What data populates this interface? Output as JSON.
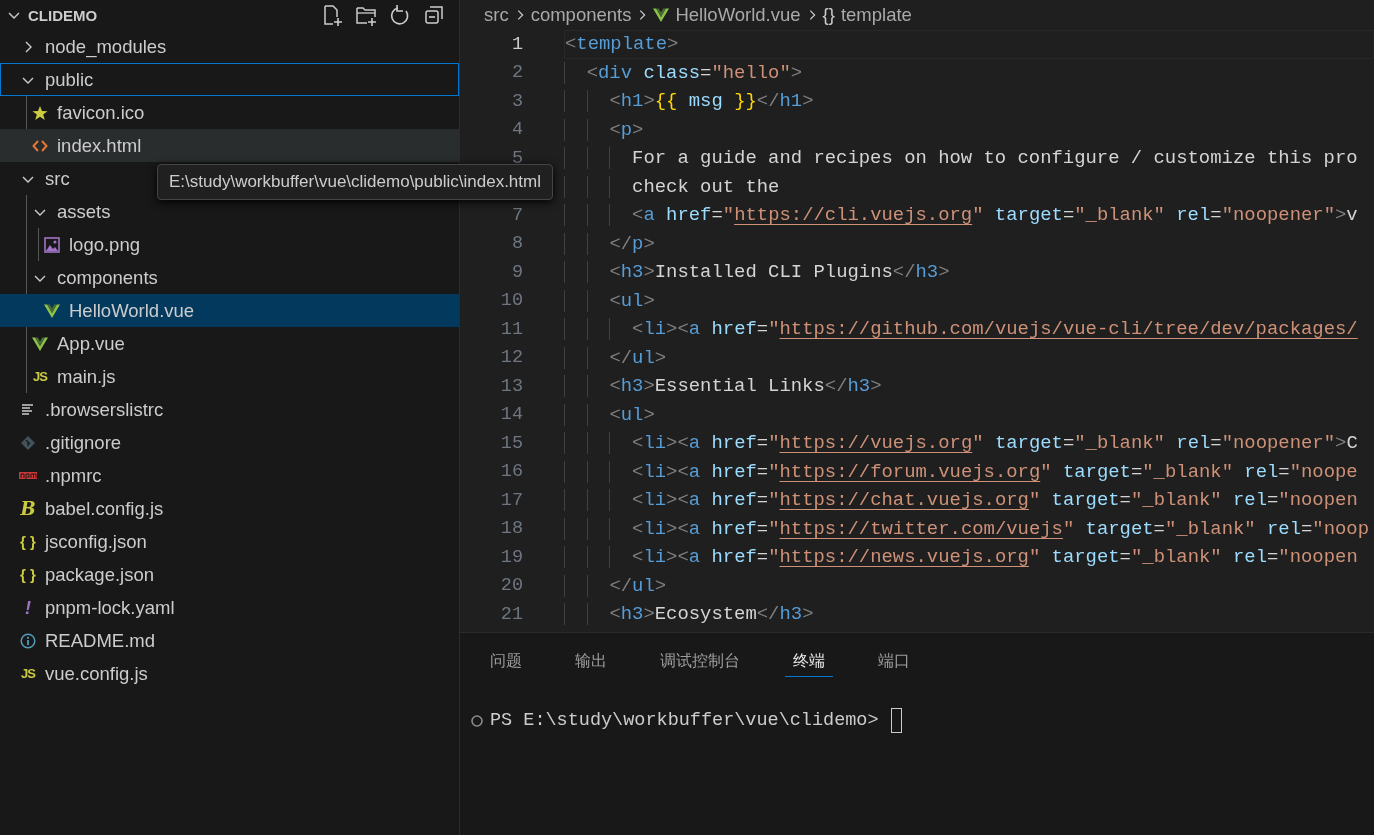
{
  "sidebar": {
    "title": "CLIDEMO",
    "expanded": true,
    "tree": [
      {
        "name": "node_modules",
        "kind": "folder",
        "expanded": false,
        "selected": false,
        "focused": false,
        "hovered": false
      },
      {
        "name": "public",
        "kind": "folder",
        "expanded": true,
        "selected": false,
        "focused": true,
        "hovered": false,
        "children": [
          {
            "name": "favicon.ico",
            "kind": "star",
            "selected": false,
            "focused": false,
            "hovered": false
          },
          {
            "name": "index.html",
            "kind": "html",
            "selected": false,
            "focused": false,
            "hovered": true
          }
        ]
      },
      {
        "name": "src",
        "kind": "folder",
        "expanded": true,
        "selected": false,
        "focused": false,
        "hovered": false,
        "children": [
          {
            "name": "assets",
            "kind": "folder",
            "expanded": true,
            "selected": false,
            "focused": false,
            "hovered": false,
            "children": [
              {
                "name": "logo.png",
                "kind": "image",
                "selected": false,
                "focused": false,
                "hovered": false
              }
            ]
          },
          {
            "name": "components",
            "kind": "folder",
            "expanded": true,
            "selected": false,
            "focused": false,
            "hovered": false,
            "children": [
              {
                "name": "HelloWorld.vue",
                "kind": "vue",
                "selected": true,
                "focused": false,
                "hovered": false
              }
            ]
          },
          {
            "name": "App.vue",
            "kind": "vue",
            "selected": false,
            "focused": false,
            "hovered": false
          },
          {
            "name": "main.js",
            "kind": "js",
            "icon_text": "JS",
            "selected": false,
            "focused": false,
            "hovered": false
          }
        ]
      },
      {
        "name": ".browserslistrc",
        "kind": "lines",
        "selected": false,
        "focused": false,
        "hovered": false
      },
      {
        "name": ".gitignore",
        "kind": "git",
        "selected": false,
        "focused": false,
        "hovered": false
      },
      {
        "name": ".npmrc",
        "kind": "npm",
        "selected": false,
        "focused": false,
        "hovered": false
      },
      {
        "name": "babel.config.js",
        "kind": "babel",
        "icon_text": "B",
        "selected": false,
        "focused": false,
        "hovered": false
      },
      {
        "name": "jsconfig.json",
        "kind": "json",
        "icon_text": "{ }",
        "selected": false,
        "focused": false,
        "hovered": false
      },
      {
        "name": "package.json",
        "kind": "json",
        "icon_text": "{ }",
        "selected": false,
        "focused": false,
        "hovered": false
      },
      {
        "name": "pnpm-lock.yaml",
        "kind": "yaml",
        "icon_text": "!",
        "selected": false,
        "focused": false,
        "hovered": false
      },
      {
        "name": "README.md",
        "kind": "info",
        "selected": false,
        "focused": false,
        "hovered": false
      },
      {
        "name": "vue.config.js",
        "kind": "js",
        "icon_text": "JS",
        "selected": false,
        "focused": false,
        "hovered": false
      }
    ]
  },
  "tooltip": {
    "text": "E:\\study\\workbuffer\\vue\\clidemo\\public\\index.html"
  },
  "breadcrumb": [
    {
      "label": "src",
      "kind": "folder"
    },
    {
      "label": "components",
      "kind": "folder"
    },
    {
      "label": "HelloWorld.vue",
      "kind": "vue"
    },
    {
      "label": "template",
      "kind": "symbol",
      "icon_text": "{}"
    }
  ],
  "editor": {
    "lines": [
      {
        "number": "1",
        "current": true,
        "tokens": [
          {
            "kind": "punct",
            "text": "<"
          },
          {
            "kind": "tag",
            "text": "template"
          },
          {
            "kind": "punct",
            "text": ">"
          }
        ]
      },
      {
        "number": "2",
        "current": false,
        "tokens": [
          {
            "kind": "punct",
            "text": "  <"
          },
          {
            "kind": "tag",
            "text": "div"
          },
          {
            "kind": "attr",
            "text": " class"
          },
          {
            "kind": "text",
            "text": "="
          },
          {
            "kind": "string",
            "text": "\"hello\""
          },
          {
            "kind": "punct",
            "text": ">"
          }
        ]
      },
      {
        "number": "3",
        "current": false,
        "tokens": [
          {
            "kind": "punct",
            "text": "    <"
          },
          {
            "kind": "tag",
            "text": "h1"
          },
          {
            "kind": "punct",
            "text": ">"
          },
          {
            "kind": "brace",
            "text": "{{"
          },
          {
            "kind": "var",
            "text": " msg "
          },
          {
            "kind": "brace",
            "text": "}}"
          },
          {
            "kind": "punct",
            "text": "</"
          },
          {
            "kind": "tag",
            "text": "h1"
          },
          {
            "kind": "punct",
            "text": ">"
          }
        ]
      },
      {
        "number": "4",
        "current": false,
        "tokens": [
          {
            "kind": "punct",
            "text": "    <"
          },
          {
            "kind": "tag",
            "text": "p"
          },
          {
            "kind": "punct",
            "text": ">"
          }
        ]
      },
      {
        "number": "5",
        "current": false,
        "tokens": [
          {
            "kind": "text",
            "text": "      For a guide and recipes on how to configure / customize this pro"
          }
        ]
      },
      {
        "current": false,
        "tokens": [
          {
            "kind": "text",
            "text": "      check out the"
          }
        ]
      },
      {
        "number": "7",
        "current": false,
        "tokens": [
          {
            "kind": "punct",
            "text": "      <"
          },
          {
            "kind": "tag",
            "text": "a"
          },
          {
            "kind": "attr",
            "text": " href"
          },
          {
            "kind": "text",
            "text": "="
          },
          {
            "kind": "string",
            "text": "\""
          },
          {
            "kind": "url",
            "text": "https://cli.vuejs.org"
          },
          {
            "kind": "string",
            "text": "\""
          },
          {
            "kind": "attr",
            "text": " target"
          },
          {
            "kind": "text",
            "text": "="
          },
          {
            "kind": "string",
            "text": "\"_blank\""
          },
          {
            "kind": "attr",
            "text": " rel"
          },
          {
            "kind": "text",
            "text": "="
          },
          {
            "kind": "string",
            "text": "\"noopener\""
          },
          {
            "kind": "punct",
            "text": ">"
          },
          {
            "kind": "text",
            "text": "v"
          }
        ]
      },
      {
        "number": "8",
        "current": false,
        "tokens": [
          {
            "kind": "punct",
            "text": "    </"
          },
          {
            "kind": "tag",
            "text": "p"
          },
          {
            "kind": "punct",
            "text": ">"
          }
        ]
      },
      {
        "number": "9",
        "current": false,
        "tokens": [
          {
            "kind": "punct",
            "text": "    <"
          },
          {
            "kind": "tag",
            "text": "h3"
          },
          {
            "kind": "punct",
            "text": ">"
          },
          {
            "kind": "text",
            "text": "Installed CLI Plugins"
          },
          {
            "kind": "punct",
            "text": "</"
          },
          {
            "kind": "tag",
            "text": "h3"
          },
          {
            "kind": "punct",
            "text": ">"
          }
        ]
      },
      {
        "number": "10",
        "current": false,
        "tokens": [
          {
            "kind": "punct",
            "text": "    <"
          },
          {
            "kind": "tag",
            "text": "ul"
          },
          {
            "kind": "punct",
            "text": ">"
          }
        ]
      },
      {
        "number": "11",
        "current": false,
        "tokens": [
          {
            "kind": "punct",
            "text": "      <"
          },
          {
            "kind": "tag",
            "text": "li"
          },
          {
            "kind": "punct",
            "text": "><"
          },
          {
            "kind": "tag",
            "text": "a"
          },
          {
            "kind": "attr",
            "text": " href"
          },
          {
            "kind": "text",
            "text": "="
          },
          {
            "kind": "string",
            "text": "\""
          },
          {
            "kind": "url",
            "text": "https://github.com/vuejs/vue-cli/tree/dev/packages/"
          }
        ]
      },
      {
        "number": "12",
        "current": false,
        "tokens": [
          {
            "kind": "punct",
            "text": "    </"
          },
          {
            "kind": "tag",
            "text": "ul"
          },
          {
            "kind": "punct",
            "text": ">"
          }
        ]
      },
      {
        "number": "13",
        "current": false,
        "tokens": [
          {
            "kind": "punct",
            "text": "    <"
          },
          {
            "kind": "tag",
            "text": "h3"
          },
          {
            "kind": "punct",
            "text": ">"
          },
          {
            "kind": "text",
            "text": "Essential Links"
          },
          {
            "kind": "punct",
            "text": "</"
          },
          {
            "kind": "tag",
            "text": "h3"
          },
          {
            "kind": "punct",
            "text": ">"
          }
        ]
      },
      {
        "number": "14",
        "current": false,
        "tokens": [
          {
            "kind": "punct",
            "text": "    <"
          },
          {
            "kind": "tag",
            "text": "ul"
          },
          {
            "kind": "punct",
            "text": ">"
          }
        ]
      },
      {
        "number": "15",
        "current": false,
        "tokens": [
          {
            "kind": "punct",
            "text": "      <"
          },
          {
            "kind": "tag",
            "text": "li"
          },
          {
            "kind": "punct",
            "text": "><"
          },
          {
            "kind": "tag",
            "text": "a"
          },
          {
            "kind": "attr",
            "text": " href"
          },
          {
            "kind": "text",
            "text": "="
          },
          {
            "kind": "string",
            "text": "\""
          },
          {
            "kind": "url",
            "text": "https://vuejs.org"
          },
          {
            "kind": "string",
            "text": "\""
          },
          {
            "kind": "attr",
            "text": " target"
          },
          {
            "kind": "text",
            "text": "="
          },
          {
            "kind": "string",
            "text": "\"_blank\""
          },
          {
            "kind": "attr",
            "text": " rel"
          },
          {
            "kind": "text",
            "text": "="
          },
          {
            "kind": "string",
            "text": "\"noopener\""
          },
          {
            "kind": "punct",
            "text": ">"
          },
          {
            "kind": "text",
            "text": "C"
          }
        ]
      },
      {
        "number": "16",
        "current": false,
        "tokens": [
          {
            "kind": "punct",
            "text": "      <"
          },
          {
            "kind": "tag",
            "text": "li"
          },
          {
            "kind": "punct",
            "text": "><"
          },
          {
            "kind": "tag",
            "text": "a"
          },
          {
            "kind": "attr",
            "text": " href"
          },
          {
            "kind": "text",
            "text": "="
          },
          {
            "kind": "string",
            "text": "\""
          },
          {
            "kind": "url",
            "text": "https://forum.vuejs.org"
          },
          {
            "kind": "string",
            "text": "\""
          },
          {
            "kind": "attr",
            "text": " target"
          },
          {
            "kind": "text",
            "text": "="
          },
          {
            "kind": "string",
            "text": "\"_blank\""
          },
          {
            "kind": "attr",
            "text": " rel"
          },
          {
            "kind": "text",
            "text": "="
          },
          {
            "kind": "string",
            "text": "\"noope"
          }
        ]
      },
      {
        "number": "17",
        "current": false,
        "tokens": [
          {
            "kind": "punct",
            "text": "      <"
          },
          {
            "kind": "tag",
            "text": "li"
          },
          {
            "kind": "punct",
            "text": "><"
          },
          {
            "kind": "tag",
            "text": "a"
          },
          {
            "kind": "attr",
            "text": " href"
          },
          {
            "kind": "text",
            "text": "="
          },
          {
            "kind": "string",
            "text": "\""
          },
          {
            "kind": "url",
            "text": "https://chat.vuejs.org"
          },
          {
            "kind": "string",
            "text": "\""
          },
          {
            "kind": "attr",
            "text": " target"
          },
          {
            "kind": "text",
            "text": "="
          },
          {
            "kind": "string",
            "text": "\"_blank\""
          },
          {
            "kind": "attr",
            "text": " rel"
          },
          {
            "kind": "text",
            "text": "="
          },
          {
            "kind": "string",
            "text": "\"noopen"
          }
        ]
      },
      {
        "number": "18",
        "current": false,
        "tokens": [
          {
            "kind": "punct",
            "text": "      <"
          },
          {
            "kind": "tag",
            "text": "li"
          },
          {
            "kind": "punct",
            "text": "><"
          },
          {
            "kind": "tag",
            "text": "a"
          },
          {
            "kind": "attr",
            "text": " href"
          },
          {
            "kind": "text",
            "text": "="
          },
          {
            "kind": "string",
            "text": "\""
          },
          {
            "kind": "url",
            "text": "https://twitter.com/vuejs"
          },
          {
            "kind": "string",
            "text": "\""
          },
          {
            "kind": "attr",
            "text": " target"
          },
          {
            "kind": "text",
            "text": "="
          },
          {
            "kind": "string",
            "text": "\"_blank\""
          },
          {
            "kind": "attr",
            "text": " rel"
          },
          {
            "kind": "text",
            "text": "="
          },
          {
            "kind": "string",
            "text": "\"noop"
          }
        ]
      },
      {
        "number": "19",
        "current": false,
        "tokens": [
          {
            "kind": "punct",
            "text": "      <"
          },
          {
            "kind": "tag",
            "text": "li"
          },
          {
            "kind": "punct",
            "text": "><"
          },
          {
            "kind": "tag",
            "text": "a"
          },
          {
            "kind": "attr",
            "text": " href"
          },
          {
            "kind": "text",
            "text": "="
          },
          {
            "kind": "string",
            "text": "\""
          },
          {
            "kind": "url",
            "text": "https://news.vuejs.org"
          },
          {
            "kind": "string",
            "text": "\""
          },
          {
            "kind": "attr",
            "text": " target"
          },
          {
            "kind": "text",
            "text": "="
          },
          {
            "kind": "string",
            "text": "\"_blank\""
          },
          {
            "kind": "attr",
            "text": " rel"
          },
          {
            "kind": "text",
            "text": "="
          },
          {
            "kind": "string",
            "text": "\"noopen"
          }
        ]
      },
      {
        "number": "20",
        "current": false,
        "tokens": [
          {
            "kind": "punct",
            "text": "    </"
          },
          {
            "kind": "tag",
            "text": "ul"
          },
          {
            "kind": "punct",
            "text": ">"
          }
        ]
      },
      {
        "number": "21",
        "current": false,
        "tokens": [
          {
            "kind": "punct",
            "text": "    <"
          },
          {
            "kind": "tag",
            "text": "h3"
          },
          {
            "kind": "punct",
            "text": ">"
          },
          {
            "kind": "text",
            "text": "Ecosystem"
          },
          {
            "kind": "punct",
            "text": "</"
          },
          {
            "kind": "tag",
            "text": "h3"
          },
          {
            "kind": "punct",
            "text": ">"
          }
        ]
      }
    ]
  },
  "panel": {
    "tabs": [
      {
        "label": "问题",
        "selected": false
      },
      {
        "label": "输出",
        "selected": false
      },
      {
        "label": "调试控制台",
        "selected": false
      },
      {
        "label": "终端",
        "selected": true
      },
      {
        "label": "端口",
        "selected": false
      }
    ],
    "terminal": {
      "prompt": "PS E:\\study\\workbuffer\\vue\\clidemo>"
    }
  }
}
